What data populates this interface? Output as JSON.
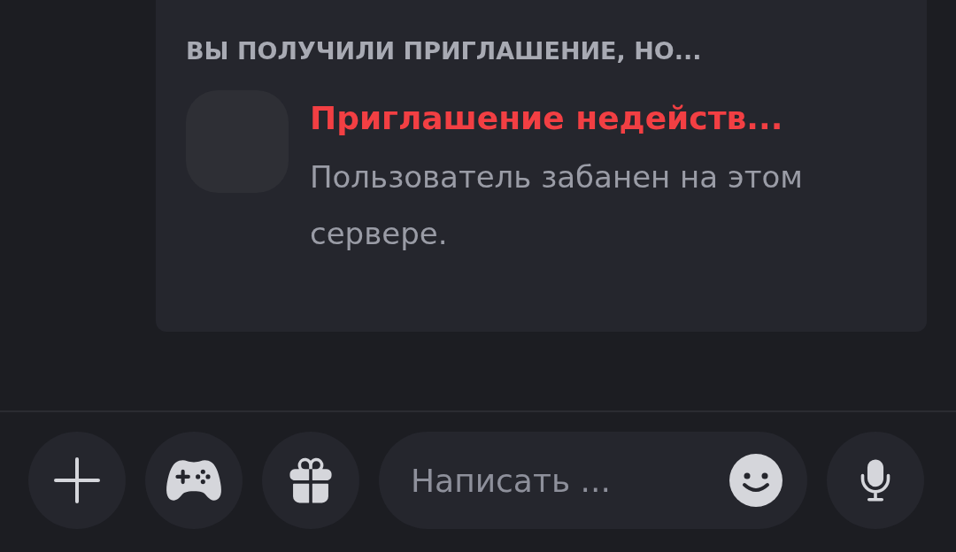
{
  "invite": {
    "heading": "ВЫ ПОЛУЧИЛИ ПРИГЛАШЕНИЕ, НО...",
    "title": "Приглашение недейств...",
    "message": "Пользователь забанен на этом сервере."
  },
  "composer": {
    "placeholder": "Написать ..."
  }
}
